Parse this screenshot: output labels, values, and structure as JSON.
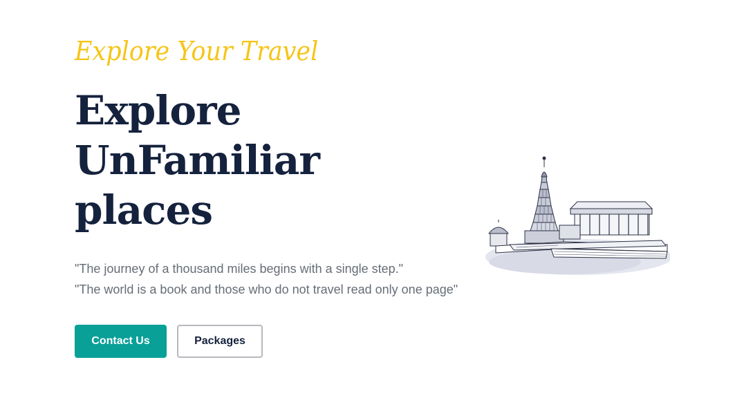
{
  "hero": {
    "tagline": "Explore Your Travel",
    "headline_lines": [
      "Explore",
      "UnFamiliar",
      "places"
    ],
    "quotes": [
      "\"The journey of a thousand miles begins with a single step.\"",
      "\"The world is a book and those who do not travel read only one page\""
    ],
    "buttons": {
      "contact": "Contact Us",
      "packages": "Packages"
    },
    "illustration_icon": "temple-sketch-icon"
  },
  "colors": {
    "tagline": "#f5c518",
    "headline": "#15223d",
    "body_text": "#666d76",
    "primary_button": "#09a098",
    "secondary_button_border": "#b5b8bd"
  }
}
